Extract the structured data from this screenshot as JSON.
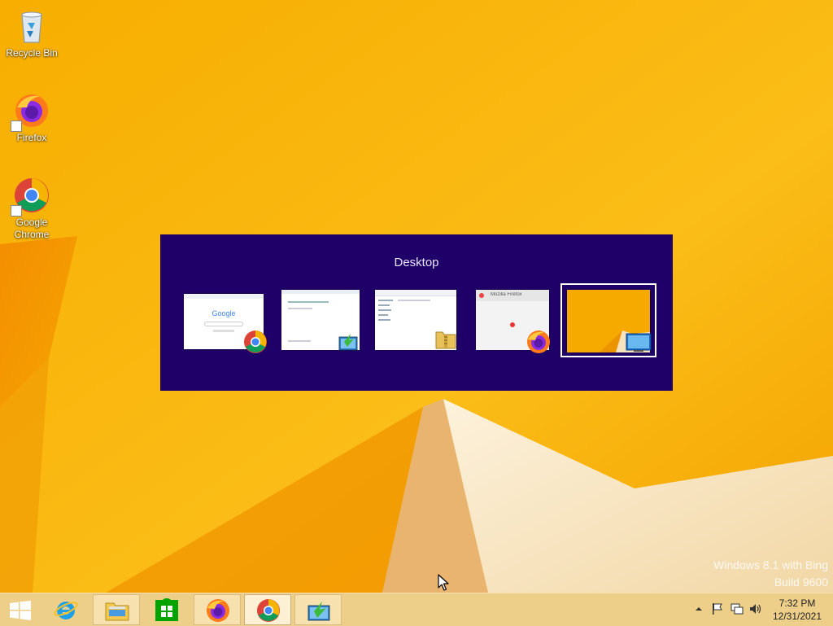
{
  "desktop": {
    "icons": [
      {
        "label": "Recycle Bin",
        "icon": "recycle-bin-icon"
      },
      {
        "label": "Firefox",
        "icon": "firefox-icon"
      },
      {
        "label": "Google Chrome",
        "icon": "chrome-icon"
      }
    ],
    "watermark": {
      "line1": "Windows 8.1 with Bing",
      "line2": "Build 9600"
    }
  },
  "switcher": {
    "title": "Desktop",
    "windows": [
      {
        "app": "Google Chrome",
        "icon": "chrome-icon",
        "preview_text": "Google",
        "selected": false
      },
      {
        "app": "Windows Easy Transfer",
        "icon": "easy-transfer-icon",
        "selected": false
      },
      {
        "app": "File Explorer",
        "icon": "zip-folder-icon",
        "selected": false
      },
      {
        "app": "Firefox",
        "icon": "firefox-icon",
        "preview_text": "Mozilla Firefox",
        "selected": false
      },
      {
        "app": "Desktop",
        "icon": "desktop-icon",
        "selected": true
      }
    ]
  },
  "taskbar": {
    "buttons": [
      {
        "name": "start",
        "icon": "windows-logo-icon"
      },
      {
        "name": "internet-explorer",
        "icon": "ie-icon"
      },
      {
        "name": "file-explorer",
        "icon": "folder-icon"
      },
      {
        "name": "store",
        "icon": "store-icon"
      },
      {
        "name": "firefox",
        "icon": "firefox-icon"
      },
      {
        "name": "chrome",
        "icon": "chrome-icon"
      },
      {
        "name": "easy-transfer",
        "icon": "easy-transfer-icon"
      }
    ],
    "tray": {
      "icons": [
        "show-hidden-icons-chevron",
        "action-center-flag-icon",
        "network-icon",
        "volume-icon"
      ],
      "time": "7:32 PM",
      "date": "12/31/2021"
    }
  },
  "colors": {
    "wallpaper": "#f5a900",
    "switcher_bg": "#1f0068",
    "taskbar": "#ecd296"
  }
}
